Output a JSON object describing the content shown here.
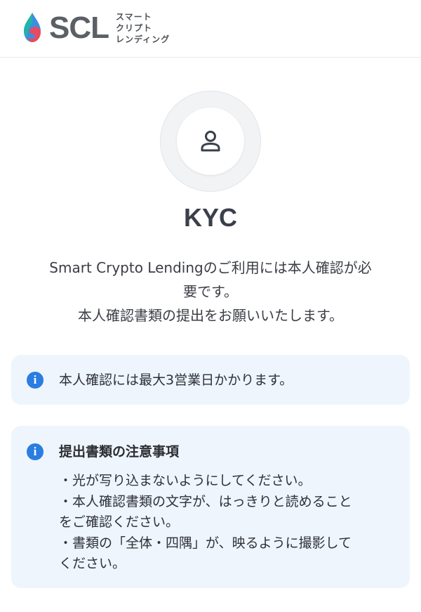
{
  "header": {
    "logo_text": "SCL",
    "logo_sub": [
      "スマート",
      "クリプト",
      "レンディング"
    ]
  },
  "avatar": {
    "icon": "user-icon"
  },
  "title": "KYC",
  "description": {
    "line1": "Smart Crypto Lendingのご利用には本人確認が必",
    "line2": "要です。",
    "line3": "本人確認書類の提出をお願いいたします。"
  },
  "info_notice": {
    "icon": "info-icon",
    "text": "本人確認には最大3営業日かかります。"
  },
  "notes": {
    "icon": "info-icon",
    "title": "提出書類の注意事項",
    "items": [
      {
        "line1": "・光が写り込まないようにしてください。",
        "line2": ""
      },
      {
        "line1": "・本人確認書類の文字が、はっきりと読めること",
        "line2": "をご確認ください。"
      },
      {
        "line1": "・書類の「全体・四隅」が、映るように撮影して",
        "line2": "ください。"
      }
    ]
  },
  "colors": {
    "accent": "#2a7de1",
    "info_bg": "#eef5fd",
    "logo_red": "#e84a5f",
    "logo_teal": "#24b3a8",
    "logo_blue": "#3b8fe0"
  }
}
